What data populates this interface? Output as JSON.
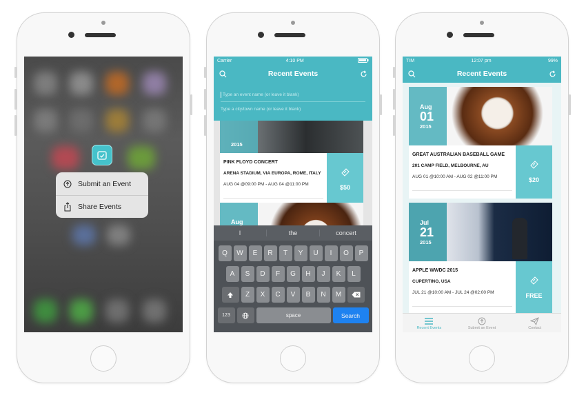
{
  "phone1": {
    "quick_actions": [
      {
        "label": "Submit an Event",
        "icon": "arrow-up-circle-icon"
      },
      {
        "label": "Share Events",
        "icon": "share-icon"
      }
    ]
  },
  "phone2": {
    "status": {
      "carrier": "Carrier",
      "time": "4:10 PM"
    },
    "nav": {
      "title": "Recent Events"
    },
    "search": {
      "event_placeholder": "Type an event name (or leave it blank)",
      "city_placeholder": "Type a city/town name (or leave it blank)"
    },
    "card1": {
      "year": "2015",
      "title": "PINK FLOYD CONCERT",
      "location": "ARENA STADIUM, VIA EUROPA, ROME, ITALY",
      "dates": "AUG 04 @09:00 PM - AUG 04 @11:00 PM",
      "price": "$50"
    },
    "card2": {
      "month": "Aug"
    },
    "keyboard": {
      "suggestions": [
        "I",
        "the",
        "concert"
      ],
      "row1": [
        "Q",
        "W",
        "E",
        "R",
        "T",
        "Y",
        "U",
        "I",
        "O",
        "P"
      ],
      "row2": [
        "A",
        "S",
        "D",
        "F",
        "G",
        "H",
        "J",
        "K",
        "L"
      ],
      "row3": [
        "Z",
        "X",
        "C",
        "V",
        "B",
        "N",
        "M"
      ],
      "num_key": "123",
      "space_key": "space",
      "search_key": "Search"
    }
  },
  "phone3": {
    "status": {
      "carrier": "TIM",
      "time": "12:07 pm",
      "battery": "99%"
    },
    "nav": {
      "title": "Recent Events"
    },
    "events": [
      {
        "month": "Aug",
        "day": "01",
        "year": "2015",
        "title": "GREAT AUSTRALIAN BASEBALL GAME",
        "location": "201 CAMP FIELD, MELBOURNE, AU",
        "dates": "AUG 01 @10:00 AM - AUG 02 @11:00 PM",
        "price": "$20"
      },
      {
        "month": "Jul",
        "day": "21",
        "year": "2015",
        "title": "APPLE WWDC 2015",
        "location": "CUPERTINO, USA",
        "dates": "JUL 21 @10:00 AM - JUL 24 @02:00 PM",
        "price": "FREE"
      }
    ],
    "tabs": [
      {
        "label": "Recent Events",
        "icon": "list-icon"
      },
      {
        "label": "Submit an Event",
        "icon": "arrow-up-circle-icon"
      },
      {
        "label": "Contact",
        "icon": "paper-plane-icon"
      }
    ]
  },
  "colors": {
    "accent": "#4ab8c3",
    "price_bg": "#67c8d0",
    "search_key": "#1e82f0"
  }
}
